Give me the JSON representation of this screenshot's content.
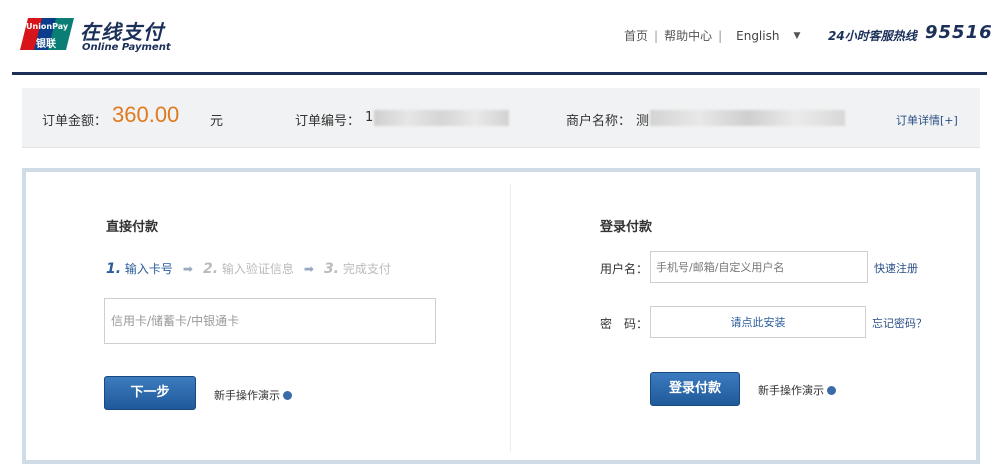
{
  "brand": {
    "logo_text": "UnionPay",
    "logo_cn": "银联",
    "title_cn": "在线支付",
    "title_en": "Online Payment"
  },
  "top_nav": {
    "home": "首页",
    "help": "帮助中心",
    "language": "English",
    "hotline_label": "24小时客服热线",
    "hotline_number": "95516"
  },
  "order": {
    "amount_label": "订单金额：",
    "amount_value": "360.00",
    "amount_unit": "元",
    "order_no_label": "订单编号：",
    "order_no_visible": "1",
    "merchant_label": "商户名称：",
    "merchant_visible": "测",
    "detail_link": "订单详情[+]"
  },
  "direct_pay": {
    "title": "直接付款",
    "steps": [
      {
        "num": "1.",
        "label": "输入卡号"
      },
      {
        "num": "2.",
        "label": "输入验证信息"
      },
      {
        "num": "3.",
        "label": "完成支付"
      }
    ],
    "card_placeholder": "信用卡/储蓄卡/中银通卡",
    "next_button": "下一步",
    "demo_link": "新手操作演示"
  },
  "login_pay": {
    "title": "登录付款",
    "username_label": "用户名：",
    "username_placeholder": "手机号/邮箱/自定义用户名",
    "password_label": "密　码：",
    "password_hint": "请点此安装",
    "quick_register": "快速注册",
    "forgot_password": "忘记密码？",
    "login_button": "登录付款",
    "demo_link": "新手操作演示"
  }
}
